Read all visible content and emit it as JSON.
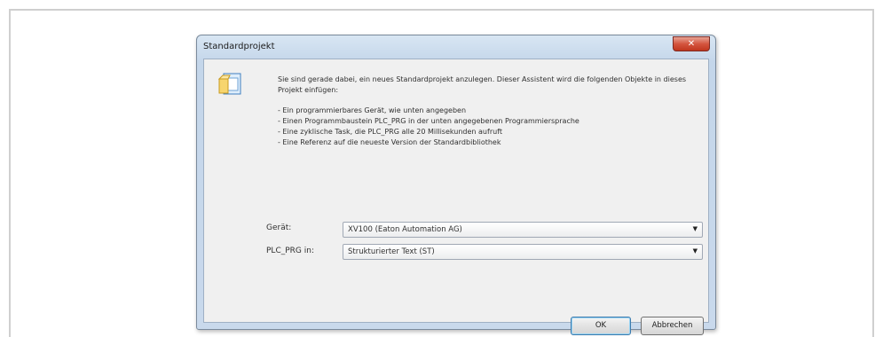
{
  "dialog": {
    "title": "Standardprojekt",
    "close_glyph": "✕",
    "description": "Sie sind gerade dabei, ein neues Standardprojekt anzulegen. Dieser Assistent wird die folgenden Objekte in dieses Projekt einfügen:",
    "bullets": [
      "- Ein programmierbares Gerät, wie unten angegeben",
      "- Einen Programmbaustein PLC_PRG in der unten angegebenen Programmiersprache",
      "- Eine zyklische Task, die PLC_PRG alle 20 Millisekunden aufruft",
      "- Eine Referenz auf die neueste Version der Standardbibliothek"
    ],
    "device": {
      "label": "Gerät:",
      "value": "XV100 (Eaton Automation AG)"
    },
    "plc_prg": {
      "label": "PLC_PRG in:",
      "value": "Strukturierter Text (ST)"
    },
    "buttons": {
      "ok": "OK",
      "cancel": "Abbrechen"
    }
  },
  "icons": {
    "app": "project-wizard-icon",
    "dropdown": "chevron-down-icon",
    "close": "close-icon"
  },
  "colors": {
    "title_frame": "#c9d9ec",
    "close_button": "#c0371f",
    "client_bg": "#f0f0f0"
  }
}
